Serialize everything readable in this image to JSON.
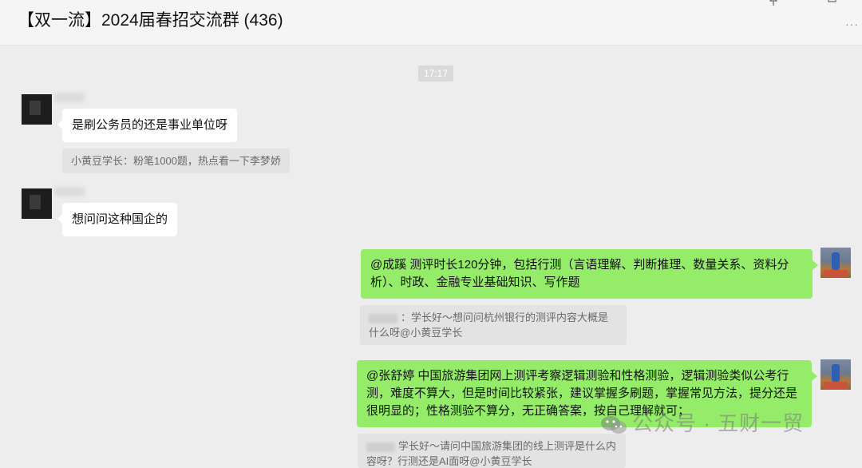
{
  "window": {
    "title": "【双一流】2024届春招交流群 (436)",
    "more": "···"
  },
  "chat": {
    "time_divider": "17:17",
    "messages": [
      {
        "text": "是刷公务员的还是事业单位呀"
      },
      {
        "quote": "小黄豆学长：粉笔1000题，热点看一下李梦娇"
      },
      {
        "text": "想问问这种国企的"
      },
      {
        "text": "@成蹊 测评时长120分钟，包括行测（言语理解、判断推理、数量关系、资料分析）、时政、金融专业基础知识、写作题"
      },
      {
        "quote": "：学长好～想问问杭州银行的测评内容大概是什么呀@小黄豆学长"
      },
      {
        "text": "@张舒婷 中国旅游集团网上测评考察逻辑测验和性格测验，逻辑测验类似公考行测，难度不算大，但是时间比较紧张，建议掌握多刷题，掌握常见方法，提分还是很明显的；性格测验不算分，无正确答案，按自己理解就可；"
      },
      {
        "quote": "学长好～请问中国旅游集团的线上测评是什么内容呀？行测还是AI面呀@小黄豆学长"
      }
    ]
  },
  "watermark": {
    "text": "公众号 · 五财一贸"
  },
  "colors": {
    "outgoing_bubble": "#95ec69",
    "incoming_bubble": "#ffffff",
    "background": "#ededed"
  }
}
